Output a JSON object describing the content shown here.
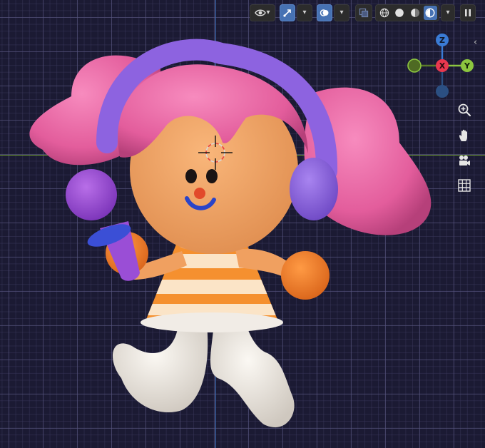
{
  "header": {
    "buttons": [
      {
        "id": "view-object-types",
        "icon": "eye-icon",
        "has_dropdown": true
      },
      {
        "id": "transform-gizmo",
        "icon": "gizmo-arrow-icon",
        "has_dropdown": true,
        "active": true
      },
      {
        "id": "overlays",
        "icon": "overlays-icon",
        "has_dropdown": true,
        "active": true
      },
      {
        "id": "xray-toggle",
        "icon": "xray-icon"
      },
      {
        "id": "shading-wireframe",
        "icon": "wireframe-sphere-icon"
      },
      {
        "id": "shading-solid",
        "icon": "solid-sphere-icon"
      },
      {
        "id": "shading-material",
        "icon": "material-sphere-icon"
      },
      {
        "id": "shading-rendered",
        "icon": "rendered-sphere-icon",
        "active": true
      },
      {
        "id": "shading-options",
        "icon": "chevron-down-icon"
      },
      {
        "id": "pause-render",
        "icon": "pause-icon"
      }
    ]
  },
  "gizmo": {
    "z_label": "Z",
    "x_label": "X",
    "y_label": "Y",
    "colors": {
      "x": "#e8384f",
      "y": "#8cc63f",
      "z": "#3a7bd5",
      "neg_x": "#5b7a2a",
      "neg_z": "#2b4f82"
    }
  },
  "navigation": [
    {
      "id": "zoom",
      "icon": "zoom-icon"
    },
    {
      "id": "pan",
      "icon": "hand-icon"
    },
    {
      "id": "camera",
      "icon": "camera-icon"
    },
    {
      "id": "ortho",
      "icon": "grid-icon"
    }
  ],
  "sidebar_toggle": {
    "icon": "chevron-left-icon",
    "glyph": "‹"
  },
  "scene": {
    "subject": "character-figure",
    "colors": {
      "background": "#1b1a33",
      "hair": "#e8609f",
      "headphones": "#8d63e0",
      "skin": "#f3a364",
      "dress_orange": "#f5902f",
      "dress_stripe": "#fbe4c7",
      "legs": "#efeae3",
      "mic": "#9a4ed6",
      "mic_band": "#3b4fd6",
      "hand": "#f47b25"
    }
  }
}
